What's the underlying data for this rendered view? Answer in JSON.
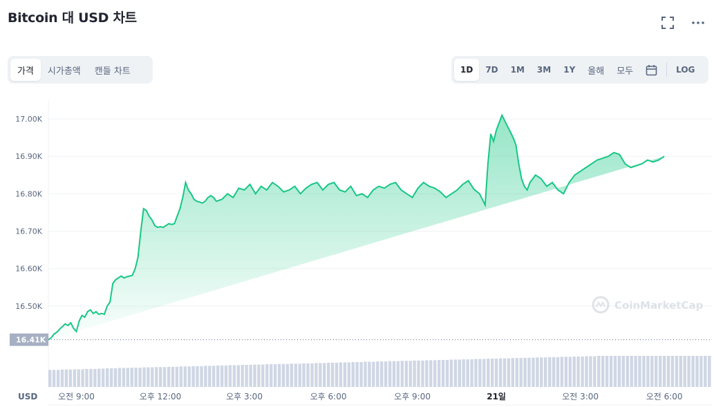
{
  "header": {
    "title": "Bitcoin 대 USD 차트"
  },
  "icons": {
    "fullscreen": "fullscreen-icon",
    "more": "more-icon",
    "calendar": "calendar-icon",
    "watermark": "coinmarketcap-logo-icon"
  },
  "tabs_left": [
    {
      "label": "가격",
      "active": true
    },
    {
      "label": "시가총액",
      "active": false
    },
    {
      "label": "캔들 차트",
      "active": false
    }
  ],
  "tabs_right": [
    {
      "label": "1D",
      "active": true
    },
    {
      "label": "7D",
      "active": false
    },
    {
      "label": "1M",
      "active": false
    },
    {
      "label": "3M",
      "active": false
    },
    {
      "label": "1Y",
      "active": false
    },
    {
      "label": "올해",
      "active": false
    },
    {
      "label": "모두",
      "active": false
    }
  ],
  "log_label": "LOG",
  "watermark_text": "CoinMarketCap",
  "currency_label": "USD",
  "colors": {
    "line": "#16c784",
    "text_muted": "#58667e",
    "volume": "#cfd6e4",
    "price_badge": "#a6b0c3"
  },
  "chart_data": {
    "type": "area",
    "ylim": [
      16400,
      17050
    ],
    "y_ticks": [
      {
        "label": "17.00K",
        "value": 17000
      },
      {
        "label": "16.90K",
        "value": 16900
      },
      {
        "label": "16.80K",
        "value": 16800
      },
      {
        "label": "16.70K",
        "value": 16700
      },
      {
        "label": "16.60K",
        "value": 16600
      },
      {
        "label": "16.50K",
        "value": 16500
      }
    ],
    "current_price_label": "16.41K",
    "current_price_value": 16410,
    "x_ticks": [
      {
        "label": "오전 9:00",
        "hour": 1,
        "bold": false
      },
      {
        "label": "오후 12:00",
        "hour": 4,
        "bold": false
      },
      {
        "label": "오후 3:00",
        "hour": 7,
        "bold": false
      },
      {
        "label": "오후 6:00",
        "hour": 10,
        "bold": false
      },
      {
        "label": "오후 9:00",
        "hour": 13,
        "bold": false
      },
      {
        "label": "21일",
        "hour": 16,
        "bold": true
      },
      {
        "label": "오전 3:00",
        "hour": 19,
        "bold": false
      },
      {
        "label": "오전 6:00",
        "hour": 22,
        "bold": false
      }
    ],
    "xlim": [
      0,
      23.7
    ],
    "x": [
      0,
      0.1,
      0.2,
      0.3,
      0.4,
      0.5,
      0.6,
      0.7,
      0.8,
      0.9,
      1.0,
      1.1,
      1.2,
      1.3,
      1.4,
      1.5,
      1.6,
      1.7,
      1.8,
      1.9,
      2.0,
      2.1,
      2.2,
      2.3,
      2.4,
      2.5,
      2.6,
      2.7,
      2.8,
      2.9,
      3.0,
      3.1,
      3.2,
      3.3,
      3.4,
      3.5,
      3.6,
      3.7,
      3.8,
      3.9,
      4.0,
      4.1,
      4.2,
      4.3,
      4.4,
      4.5,
      4.6,
      4.7,
      4.8,
      4.9,
      5.0,
      5.1,
      5.2,
      5.3,
      5.4,
      5.5,
      5.6,
      5.7,
      5.8,
      5.9,
      6.0,
      6.2,
      6.4,
      6.6,
      6.8,
      7.0,
      7.2,
      7.4,
      7.6,
      7.8,
      8.0,
      8.2,
      8.4,
      8.6,
      8.8,
      9.0,
      9.2,
      9.4,
      9.6,
      9.8,
      10.0,
      10.2,
      10.4,
      10.6,
      10.8,
      11.0,
      11.2,
      11.4,
      11.6,
      11.8,
      12.0,
      12.2,
      12.4,
      12.6,
      12.8,
      13.0,
      13.2,
      13.4,
      13.6,
      13.8,
      14.0,
      14.2,
      14.4,
      14.6,
      14.8,
      15.0,
      15.2,
      15.4,
      15.6,
      15.7,
      15.8,
      15.9,
      16.0,
      16.1,
      16.2,
      16.3,
      16.4,
      16.5,
      16.6,
      16.7,
      16.8,
      16.9,
      17.0,
      17.1,
      17.2,
      17.4,
      17.6,
      17.8,
      18.0,
      18.2,
      18.4,
      18.6,
      18.8,
      19.0,
      19.2,
      19.4,
      19.6,
      19.8,
      20.0,
      20.2,
      20.4,
      20.6,
      20.8,
      21.0,
      21.2,
      21.4,
      21.6,
      21.8,
      22.0,
      22.2,
      22.4,
      22.6,
      22.8,
      23.0,
      23.2,
      23.4,
      23.6
    ],
    "values": [
      16410,
      16415,
      16425,
      16430,
      16438,
      16445,
      16452,
      16448,
      16455,
      16440,
      16432,
      16460,
      16475,
      16470,
      16485,
      16490,
      16480,
      16485,
      16478,
      16480,
      16478,
      16500,
      16510,
      16560,
      16570,
      16575,
      16580,
      16575,
      16578,
      16580,
      16582,
      16600,
      16630,
      16700,
      16760,
      16755,
      16740,
      16730,
      16715,
      16710,
      16712,
      16710,
      16715,
      16720,
      16718,
      16720,
      16740,
      16760,
      16790,
      16830,
      16810,
      16800,
      16785,
      16780,
      16778,
      16775,
      16780,
      16790,
      16795,
      16790,
      16780,
      16785,
      16800,
      16790,
      16815,
      16810,
      16825,
      16800,
      16820,
      16810,
      16830,
      16820,
      16805,
      16810,
      16820,
      16800,
      16815,
      16825,
      16830,
      16810,
      16825,
      16830,
      16810,
      16805,
      16820,
      16795,
      16800,
      16790,
      16810,
      16820,
      16815,
      16825,
      16830,
      16810,
      16800,
      16790,
      16815,
      16830,
      16820,
      16815,
      16805,
      16790,
      16800,
      16810,
      16825,
      16835,
      16812,
      16800,
      16770,
      16880,
      16960,
      16940,
      16970,
      16990,
      17010,
      16995,
      16980,
      16965,
      16950,
      16930,
      16880,
      16840,
      16820,
      16810,
      16830,
      16850,
      16840,
      16820,
      16830,
      16810,
      16800,
      16830,
      16850,
      16860,
      16870,
      16880,
      16890,
      16895,
      16900,
      16910,
      16905,
      16880,
      16870,
      16875,
      16880,
      16890,
      16885,
      16890,
      16900
    ]
  },
  "volume_data": {
    "values": [
      0.55,
      0.55,
      0.55,
      0.56,
      0.56,
      0.56,
      0.57,
      0.57,
      0.57,
      0.58,
      0.58,
      0.58,
      0.59,
      0.59,
      0.6,
      0.6,
      0.6,
      0.61,
      0.61,
      0.61,
      0.62,
      0.62,
      0.62,
      0.63,
      0.63,
      0.63,
      0.64,
      0.64,
      0.64,
      0.65,
      0.65,
      0.65,
      0.66,
      0.66,
      0.66,
      0.67,
      0.67,
      0.67,
      0.68,
      0.68,
      0.68,
      0.69,
      0.69,
      0.69,
      0.7,
      0.7,
      0.7,
      0.71,
      0.71,
      0.71,
      0.72,
      0.72,
      0.72,
      0.73,
      0.73,
      0.73,
      0.74,
      0.74,
      0.74,
      0.75,
      0.75,
      0.75,
      0.76,
      0.76,
      0.76,
      0.77,
      0.77,
      0.77,
      0.78,
      0.78,
      0.78,
      0.79,
      0.79,
      0.79,
      0.8,
      0.8,
      0.8,
      0.81,
      0.81,
      0.81,
      0.82,
      0.82,
      0.82,
      0.83,
      0.83,
      0.83,
      0.84,
      0.84,
      0.84,
      0.85,
      0.85,
      0.85,
      0.86,
      0.86,
      0.86,
      0.87,
      0.87,
      0.87,
      0.88,
      0.88,
      0.88,
      0.89,
      0.89,
      0.89,
      0.9,
      0.9,
      0.9,
      0.91,
      0.91,
      0.91,
      0.92,
      0.92,
      0.92,
      0.93,
      0.93,
      0.93,
      0.94,
      0.94,
      0.94,
      0.95,
      0.95,
      0.95,
      0.96,
      0.96,
      0.96,
      0.97,
      0.97,
      0.97,
      0.98,
      0.98,
      0.98,
      0.99,
      0.99,
      0.99,
      1.0,
      1.0,
      1.0,
      1.0,
      1.0,
      1.0,
      1.0,
      1.0,
      1.0,
      1.0,
      1.0,
      1.0,
      1.0,
      1.0,
      1.0,
      1.0,
      1.0,
      1.0,
      1.0,
      1.0,
      1.0,
      1.0,
      1.0,
      1.0,
      1.0,
      1.0,
      1.0,
      1.0
    ]
  }
}
